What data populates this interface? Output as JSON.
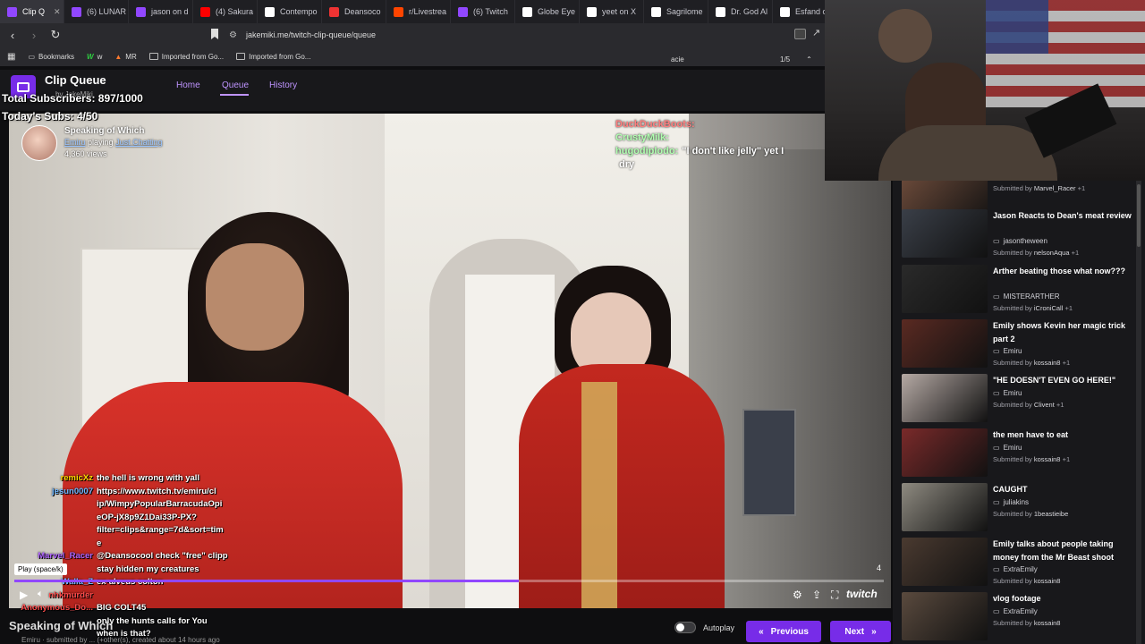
{
  "browser": {
    "tabs": [
      {
        "label": "Clip Q",
        "active": true,
        "color": "#9147ff"
      },
      {
        "label": "(6) LUNAR",
        "color": "#9147ff"
      },
      {
        "label": "jason on d",
        "color": "#9147ff"
      },
      {
        "label": "(4) Sakura",
        "color": "#ff0000"
      },
      {
        "label": "Contempo",
        "color": "#ffffff"
      },
      {
        "label": "Deansoco",
        "color": "#e33"
      },
      {
        "label": "r/Livestrea",
        "color": "#ff4500"
      },
      {
        "label": "(6) Twitch",
        "color": "#9147ff"
      },
      {
        "label": "Globe Eye",
        "color": "#ffffff"
      },
      {
        "label": "yeet on X",
        "color": "#ffffff"
      },
      {
        "label": "Sagrilome",
        "color": "#ffffff"
      },
      {
        "label": "Dr. God Al",
        "color": "#ffffff"
      },
      {
        "label": "Esfand on",
        "color": "#ffffff"
      }
    ],
    "url": "jakemiki.me/twitch-clip-queue/queue",
    "bookmarks": {
      "items": [
        {
          "label": "Bookmarks",
          "icon": "star"
        },
        {
          "label": "w",
          "icon": "w"
        },
        {
          "label": "MR",
          "icon": "fire"
        },
        {
          "label": "Imported from Go...",
          "icon": "folder"
        },
        {
          "label": "Imported from Go...",
          "icon": "folder"
        }
      ]
    },
    "find": {
      "query": "acie",
      "count": "1/5"
    }
  },
  "app": {
    "title": "Clip Queue",
    "subtitle": "by JakeMiki",
    "nav": {
      "home": "Home",
      "queue": "Queue",
      "history": "History"
    }
  },
  "overlay": {
    "total_subs": "Total Subscribers: 897/1000",
    "today_subs": "Today's Subs: 4/50"
  },
  "clip": {
    "title": "Speaking of Which",
    "channel": "Emiru",
    "playing_word": "playing",
    "game": "Just Chatting",
    "views": "4,360 views",
    "progress": 0.58,
    "count_badge": "4",
    "play_tooltip": "Play (space/k)",
    "bottom_title": "Speaking of Which",
    "bottom_meta": "Emiru · submitted by ... (+other(s), created about 14 hours ago",
    "twitch_wordmark": "twitch"
  },
  "chat_topright": [
    {
      "user": "DuckDuckBoots:",
      "msg": "",
      "color": "#ff7f7f"
    },
    {
      "user": "CrustyMilk:",
      "msg": "",
      "color": "#b0ffb0"
    },
    {
      "user": "hugodiplodo:",
      "msg": "\"I don't like jelly\" yet I",
      "color": "#b0ffb0"
    },
    {
      "user": "",
      "msg": "dry",
      "color": "#ffffff"
    }
  ],
  "chat_bottomleft": [
    {
      "user": "remicXz",
      "msg": "the hell is wrong with yall",
      "color": "#ffd700"
    },
    {
      "user": "jesun0007",
      "msg": "https://www.twitch.tv/emiru/cl",
      "color": "#6fb7ff"
    },
    {
      "user": "",
      "msg": "ip/WimpyPopularBarracudaOpi",
      "color": "#ffffff"
    },
    {
      "user": "",
      "msg": "eOP-jX8p9Z1Dai33P-PX?",
      "color": "#ffffff"
    },
    {
      "user": "",
      "msg": "filter=clips&range=7d&sort=tim",
      "color": "#ffffff"
    },
    {
      "user": "",
      "msg": "e",
      "color": "#ffffff"
    },
    {
      "user": "Marvel_Racer",
      "msg": "@Deansocool check \"free\" clipp",
      "color": "#b066ff"
    },
    {
      "user": "",
      "msg": "stay hidden my creatures",
      "color": "#ffffff"
    },
    {
      "user": "Walla_Z",
      "msg": "ex-alveus colton",
      "color": "#6fb7ff"
    },
    {
      "user": "nhkmurder",
      "msg": "",
      "color": "#ff4d4d"
    },
    {
      "user": "Anonymous_Do...",
      "msg": "BIG COLT45",
      "color": "#ff4d4d"
    },
    {
      "user": "",
      "msg": "only the hunts calls for You",
      "color": "#ffffff"
    },
    {
      "user": "",
      "msg": "when is that?",
      "color": "#ffffff"
    }
  ],
  "controls": {
    "autoplay_label": "Autoplay",
    "previous": "Previous",
    "next": "Next"
  },
  "queue": [
    {
      "title": "",
      "channel": "",
      "submitted_by": "Marvel_Racer",
      "extra": "+1",
      "thumb": "#6b4a3a"
    },
    {
      "title": "Jason Reacts to Dean's meat review",
      "channel": "jasontheween",
      "submitted_by": "nelsonAqua",
      "extra": "+1",
      "thumb": "#3a3f48"
    },
    {
      "title": "Arther beating those what now???",
      "channel": "MISTERARTHER",
      "submitted_by": "iCroniCall",
      "extra": "+1",
      "thumb": "#2a2a2a"
    },
    {
      "title": "Emily shows Kevin her magic trick part 2",
      "channel": "Emiru",
      "submitted_by": "kossain8",
      "extra": "+1",
      "thumb": "#5a2a22"
    },
    {
      "title": "\"HE DOESN'T EVEN GO HERE!\"",
      "channel": "Emiru",
      "submitted_by": "Clivent",
      "extra": "+1",
      "thumb": "#b5a9a4"
    },
    {
      "title": "the men have to eat",
      "channel": "Emiru",
      "submitted_by": "kossain8",
      "extra": "+1",
      "thumb": "#7a2a2a"
    },
    {
      "title": "CAUGHT",
      "channel": "juliakins",
      "submitted_by": "1beastieibe",
      "extra": "",
      "thumb": "#8e8a80"
    },
    {
      "title": "Emily talks about people taking money from the Mr Beast shoot",
      "channel": "ExtraEmily",
      "submitted_by": "kossain8",
      "extra": "",
      "thumb": "#4a3a30"
    },
    {
      "title": "vlog footage",
      "channel": "ExtraEmily",
      "submitted_by": "kossain8",
      "extra": "",
      "thumb": "#5a4a3e"
    }
  ],
  "labels": {
    "submitted_by": "Submitted by"
  }
}
